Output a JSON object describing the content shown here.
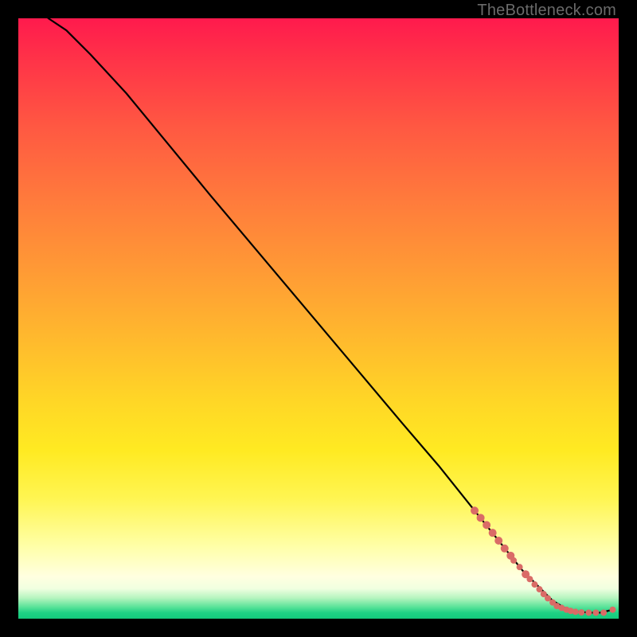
{
  "watermark": "TheBottleneck.com",
  "chart_data": {
    "type": "line",
    "title": "",
    "xlabel": "",
    "ylabel": "",
    "xlim": [
      0,
      100
    ],
    "ylim": [
      0,
      100
    ],
    "curve": {
      "name": "bottleneck-curve",
      "x": [
        5,
        8,
        12,
        18,
        25,
        32,
        40,
        48,
        56,
        64,
        70,
        76,
        80,
        84,
        87,
        89,
        91,
        93,
        95,
        97,
        99
      ],
      "y": [
        100,
        98,
        94,
        87.5,
        79,
        70.5,
        61,
        51.5,
        42,
        32.5,
        25.5,
        18,
        13,
        8,
        5,
        3,
        1.8,
        1.2,
        1.0,
        1.0,
        1.5
      ]
    },
    "markers": {
      "name": "highlight-points",
      "color": "#da6b66",
      "points": [
        {
          "x": 76,
          "y": 18,
          "r": 5
        },
        {
          "x": 77,
          "y": 16.8,
          "r": 5
        },
        {
          "x": 78,
          "y": 15.6,
          "r": 5
        },
        {
          "x": 79,
          "y": 14.3,
          "r": 5
        },
        {
          "x": 80,
          "y": 13,
          "r": 5
        },
        {
          "x": 81,
          "y": 11.7,
          "r": 5
        },
        {
          "x": 82,
          "y": 10.5,
          "r": 5
        },
        {
          "x": 82.5,
          "y": 9.7,
          "r": 4
        },
        {
          "x": 83.5,
          "y": 8.6,
          "r": 4
        },
        {
          "x": 84.5,
          "y": 7.4,
          "r": 5
        },
        {
          "x": 85.2,
          "y": 6.6,
          "r": 4
        },
        {
          "x": 86,
          "y": 5.7,
          "r": 4
        },
        {
          "x": 86.8,
          "y": 4.9,
          "r": 4
        },
        {
          "x": 87.5,
          "y": 4.1,
          "r": 4
        },
        {
          "x": 88.2,
          "y": 3.4,
          "r": 4
        },
        {
          "x": 89,
          "y": 2.7,
          "r": 4
        },
        {
          "x": 89.7,
          "y": 2.1,
          "r": 4
        },
        {
          "x": 90.5,
          "y": 1.8,
          "r": 4
        },
        {
          "x": 91.3,
          "y": 1.5,
          "r": 4
        },
        {
          "x": 92,
          "y": 1.3,
          "r": 4
        },
        {
          "x": 92.8,
          "y": 1.15,
          "r": 4
        },
        {
          "x": 93.8,
          "y": 1.05,
          "r": 4
        },
        {
          "x": 95,
          "y": 1.0,
          "r": 4
        },
        {
          "x": 96.2,
          "y": 1.0,
          "r": 4
        },
        {
          "x": 97.5,
          "y": 1.0,
          "r": 4
        },
        {
          "x": 99,
          "y": 1.5,
          "r": 4
        }
      ]
    }
  }
}
